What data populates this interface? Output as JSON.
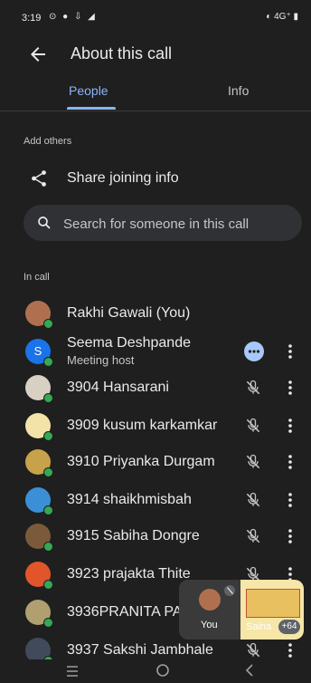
{
  "status_bar": {
    "time": "3:19",
    "left_icons": "⊙ ● ⇩ ◢",
    "right_icons": "◐ 4G⁺ ▮"
  },
  "app_bar": {
    "title": "About this call"
  },
  "tabs": [
    {
      "label": "People",
      "selected": true
    },
    {
      "label": "Info",
      "selected": false
    }
  ],
  "add_others": {
    "label": "Add others",
    "share_label": "Share joining info"
  },
  "search": {
    "placeholder": "Search for someone in this call"
  },
  "in_call": {
    "label": "In call",
    "participants": [
      {
        "name": "Rakhi Gawali (You)",
        "subtitle": "",
        "avatar_color": "#b07050",
        "mic_muted": false,
        "show_menu": false
      },
      {
        "name": "Seema Deshpande",
        "subtitle": "Meeting host",
        "avatar_color": "#1a73e8",
        "avatar_letter": "S",
        "mic_muted": false,
        "show_menu": true
      },
      {
        "name": "3904 Hansarani",
        "subtitle": "",
        "avatar_color": "#d9d0c4",
        "mic_muted": true,
        "show_menu": true
      },
      {
        "name": "3909 kusum karkamkar",
        "subtitle": "",
        "avatar_color": "#f3e3a8",
        "mic_muted": true,
        "show_menu": true
      },
      {
        "name": "3910 Priyanka Durgam",
        "subtitle": "",
        "avatar_color": "#c8a24a",
        "mic_muted": true,
        "show_menu": true
      },
      {
        "name": "3914 shaikhmisbah",
        "subtitle": "",
        "avatar_color": "#3b8fd6",
        "mic_muted": true,
        "show_menu": true
      },
      {
        "name": "3915 Sabiha Dongre",
        "subtitle": "",
        "avatar_color": "#7a5a3a",
        "mic_muted": true,
        "show_menu": true
      },
      {
        "name": "3923 prajakta Thite",
        "subtitle": "",
        "avatar_color": "#e0552a",
        "mic_muted": true,
        "show_menu": true
      },
      {
        "name": "3936PRANITA PA",
        "subtitle": "",
        "avatar_color": "#b0a070",
        "mic_muted": true,
        "show_menu": false
      },
      {
        "name": "3937 Sakshi Jambhale",
        "subtitle": "",
        "avatar_color": "#404a5a",
        "mic_muted": true,
        "show_menu": true
      }
    ]
  },
  "pip": {
    "you_label": "You",
    "other_label": "Saina",
    "more_count": "+64"
  },
  "colors": {
    "background": "#1f1f1f",
    "accent": "#8ab4f8",
    "online": "#34a853"
  }
}
